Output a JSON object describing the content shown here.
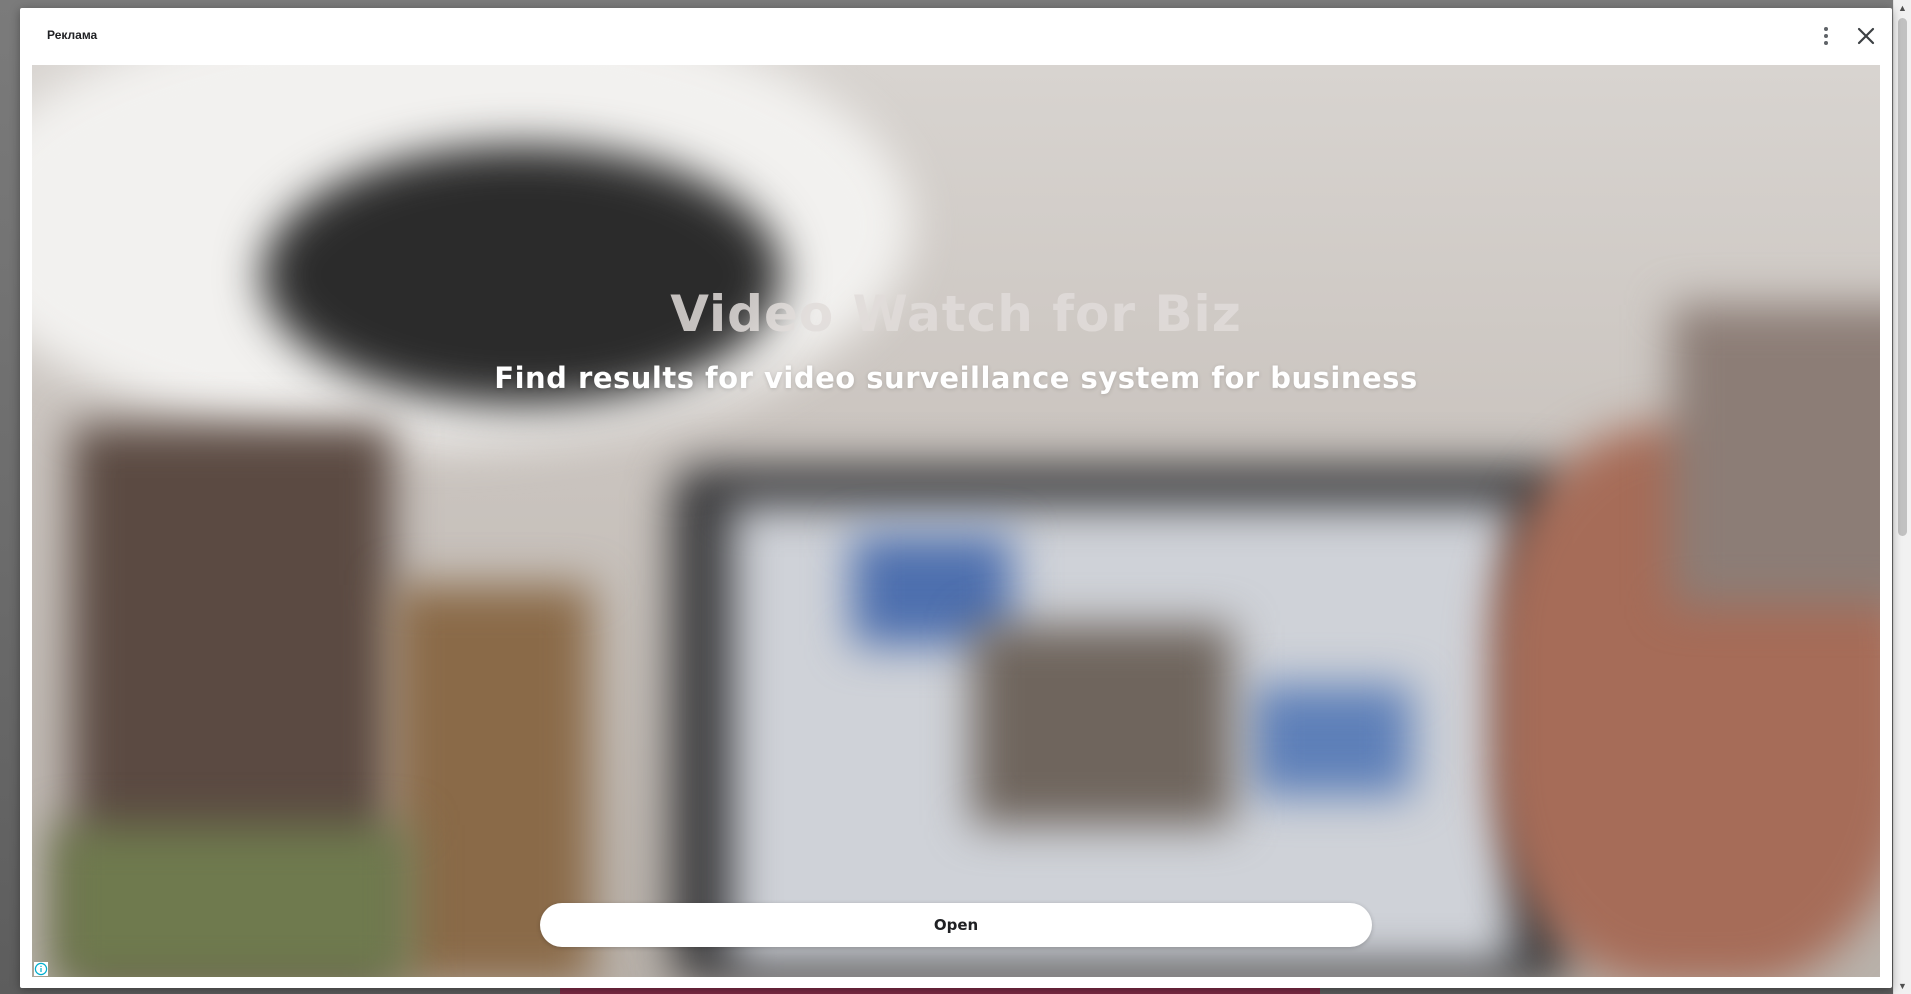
{
  "dialog": {
    "title": "Реклама",
    "more_icon": "more-vert-icon",
    "close_icon": "close-icon"
  },
  "ad": {
    "headline": "Video Watch for Biz",
    "subheadline": "Find results for video surveillance system for business",
    "cta_label": "Open",
    "info_icon": "info-icon",
    "accent_color": "#00aecd"
  }
}
